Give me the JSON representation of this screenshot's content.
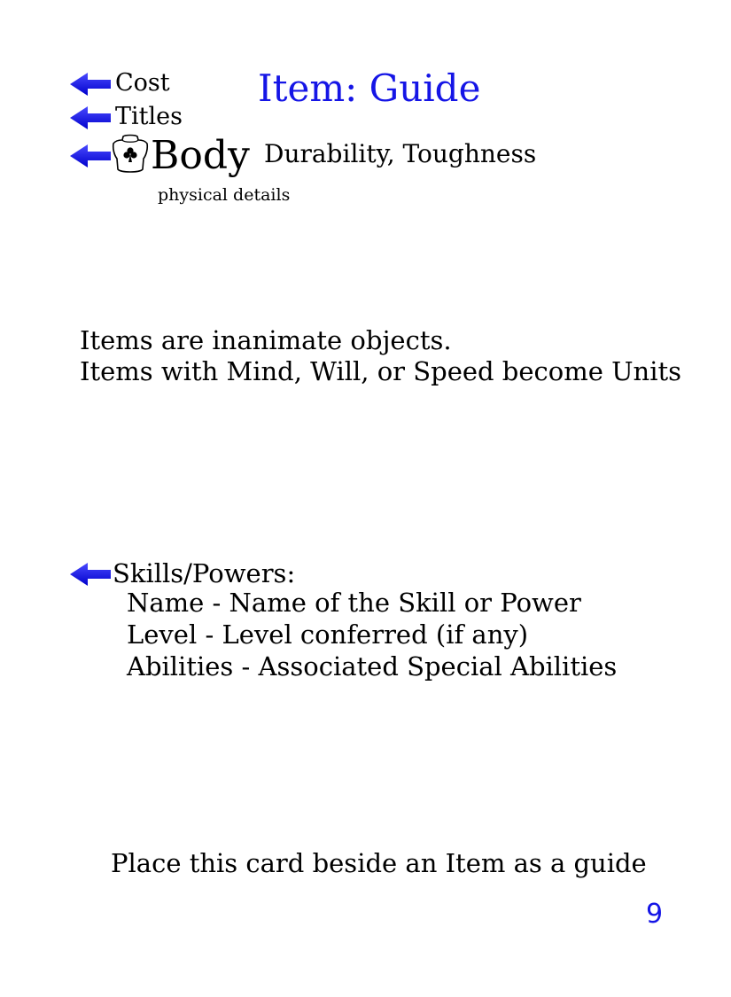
{
  "card": {
    "title": "Item: Guide",
    "stats": {
      "cost_label": "Cost",
      "titles_label": "Titles",
      "body_label": "Body",
      "body_attributes": "Durability, Toughness",
      "body_subtitle": "physical details"
    },
    "description": {
      "line1": "Items are inanimate objects.",
      "line2": "Items with Mind, Will, or Speed become Units"
    },
    "skills": {
      "heading": "Skills/Powers:",
      "lines": [
        "Name - Name of the Skill or Power",
        "Level - Level conferred (if any)",
        "Abilities - Associated Special Abilities"
      ]
    },
    "footer_text": "Place this card beside an Item as a guide",
    "page_number": "9"
  },
  "colors": {
    "accent": "#1515e6",
    "arrow": "#1a1aff"
  },
  "icons": {
    "pointer": "left-arrow-icon",
    "body": "torso-club-icon"
  }
}
